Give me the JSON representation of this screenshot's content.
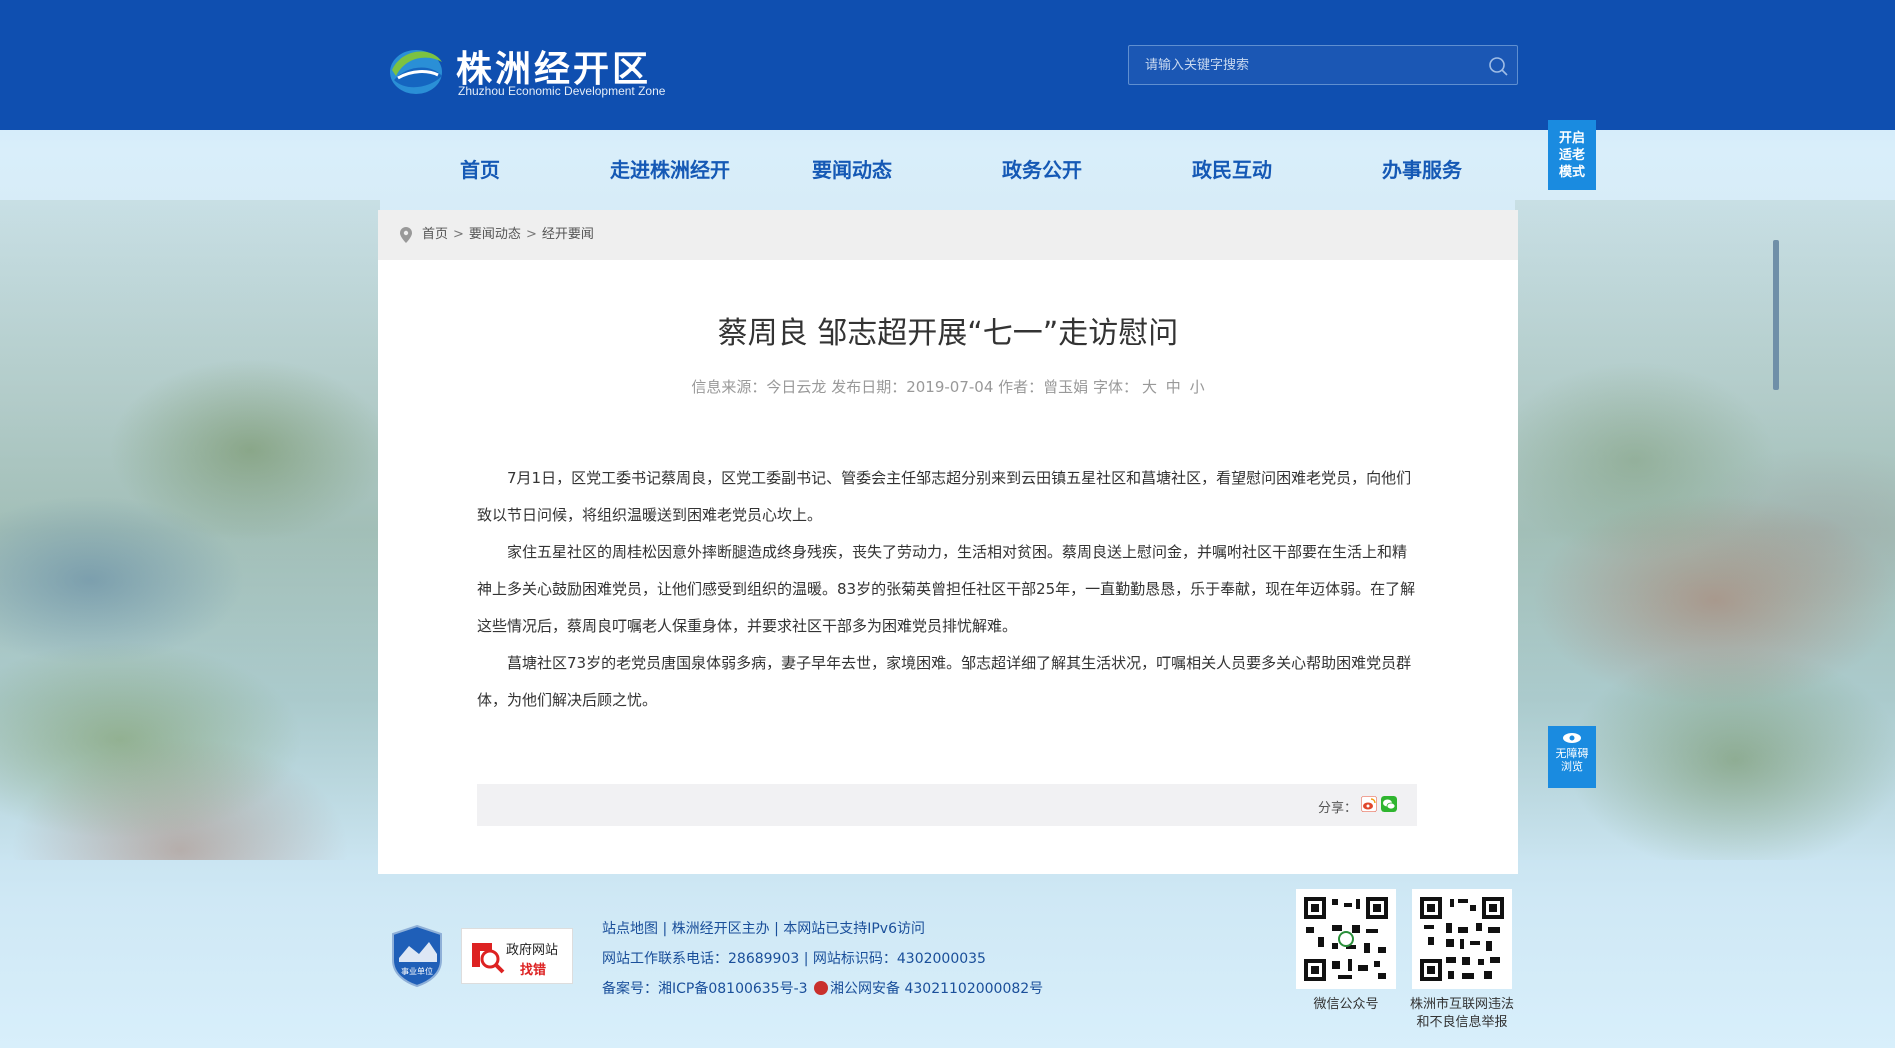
{
  "header": {
    "logo_title": "株洲经开区",
    "logo_subtitle": "Zhuzhou Economic Development Zone",
    "search_placeholder": "请输入关键字搜索"
  },
  "nav": {
    "items": [
      {
        "label": "首页"
      },
      {
        "label": "走进株洲经开"
      },
      {
        "label": "要闻动态"
      },
      {
        "label": "政务公开"
      },
      {
        "label": "政民互动"
      },
      {
        "label": "办事服务"
      }
    ]
  },
  "side_buttons": {
    "elder_mode": [
      "开启",
      "适老",
      "模式"
    ],
    "accessibility": [
      "无障碍",
      "浏览"
    ]
  },
  "breadcrumb": {
    "items": [
      "首页",
      "要闻动态",
      "经开要闻"
    ],
    "separator": ">"
  },
  "article": {
    "title": "蔡周良 邹志超开展“七一”走访慰问",
    "meta_source": "信息来源：今日云龙",
    "meta_date": "发布日期：2019-07-04",
    "meta_author": "作者：曾玉娟",
    "meta_font_label": "字体：",
    "font_sizes": [
      "大",
      "中",
      "小"
    ],
    "paragraphs": [
      "7月1日，区党工委书记蔡周良，区党工委副书记、管委会主任邹志超分别来到云田镇五星社区和菖塘社区，看望慰问困难老党员，向他们致以节日问候，将组织温暖送到困难老党员心坎上。",
      "家住五星社区的周桂松因意外摔断腿造成终身残疾，丧失了劳动力，生活相对贫困。蔡周良送上慰问金，并嘱咐社区干部要在生活上和精神上多关心鼓励困难党员，让他们感受到组织的温暖。83岁的张菊英曾担任社区干部25年，一直勤勤恳恳，乐于奉献，现在年迈体弱。在了解这些情况后，蔡周良叮嘱老人保重身体，并要求社区干部多为困难党员排忧解难。",
      "菖塘社区73岁的老党员唐国泉体弱多病，妻子早年去世，家境困难。邹志超详细了解其生活状况，叮嘱相关人员要多关心帮助困难党员群体，为他们解决后顾之忧。"
    ],
    "share_label": "分享："
  },
  "footer": {
    "badge_label": "事业单位",
    "gov_error_line1": "政府网站",
    "gov_error_line2": "找错",
    "links_line": "站点地图 | 株洲经开区主办 | 本网站已支持IPv6访问",
    "contact_line": "网站工作联系电话：28689903 | 网站标识码：4302000035",
    "icp_label": "备案号：",
    "icp": "湘ICP备08100635号-3",
    "police": "湘公网安备 43021102000082号",
    "qr1_caption": "微信公众号",
    "qr2_caption_line1": "株洲市互联网违法",
    "qr2_caption_line2": "和不良信息举报"
  },
  "colors": {
    "header_bg": "#0f4fb0",
    "nav_text": "#1559b5",
    "side_button": "#1a8be0",
    "footer_link": "#1a4f9a"
  }
}
